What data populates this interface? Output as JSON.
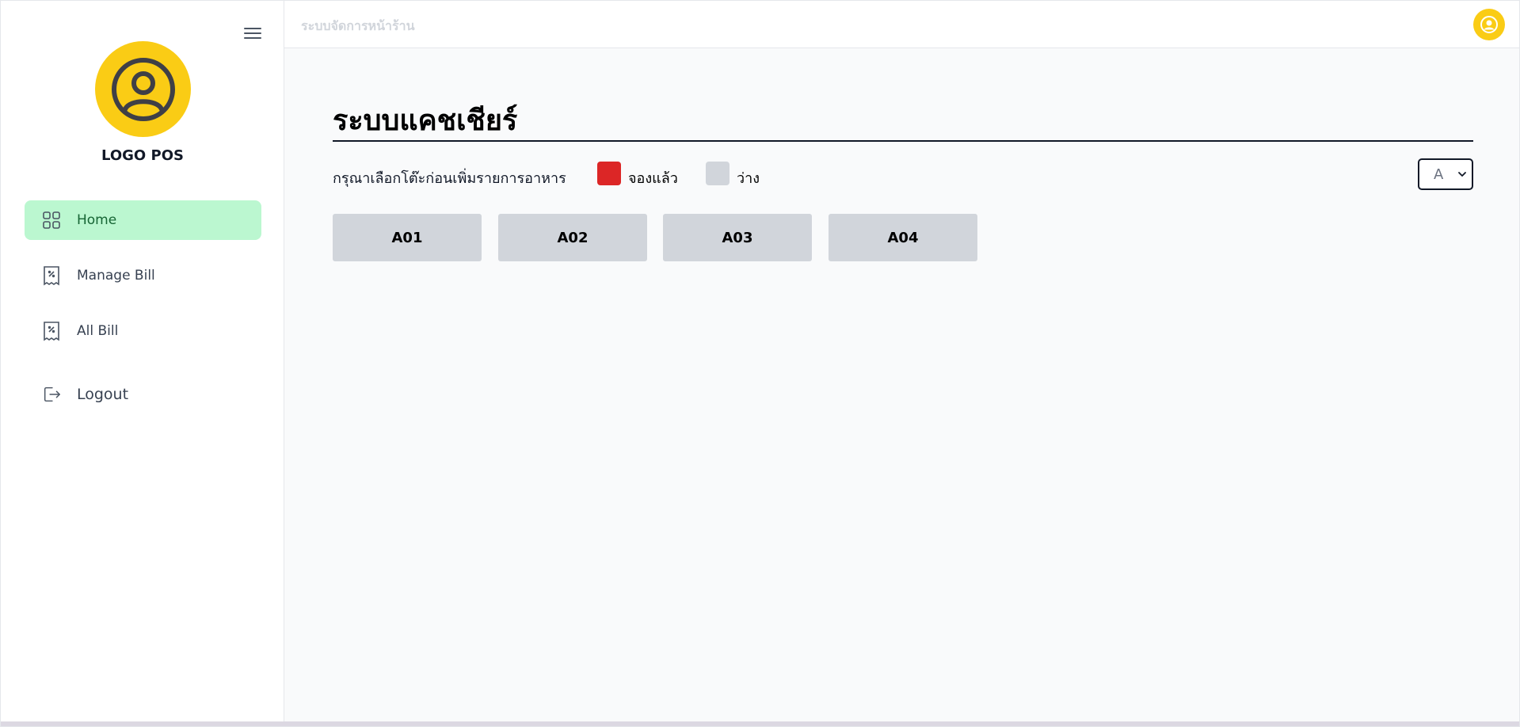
{
  "sidebar": {
    "logo_text": "LOGO POS",
    "items": [
      {
        "label": "Home",
        "icon": "grid-icon",
        "active": true
      },
      {
        "label": "Manage Bill",
        "icon": "receipt-icon"
      },
      {
        "label": "All Bill",
        "icon": "receipt-icon"
      },
      {
        "label": "Logout",
        "icon": "logout-icon"
      }
    ]
  },
  "topbar": {
    "title": "ระบบจัดการหน้าร้าน"
  },
  "main": {
    "title": "ระบบแคชเชียร์",
    "instruction": "กรุณาเลือกโต๊ะก่อนเพิ่มรายการอาหาร",
    "legend": [
      {
        "label": "จองแล้ว",
        "color": "#dc2626"
      },
      {
        "label": "ว่าง",
        "color": "#d1d5db"
      }
    ],
    "zone_select": {
      "value": "A"
    },
    "tables": [
      "A01",
      "A02",
      "A03",
      "A04"
    ]
  },
  "colors": {
    "accent_yellow": "#facc15",
    "active_nav_bg": "#bbf7d0",
    "table_available": "#d1d5db",
    "table_booked": "#dc2626"
  }
}
